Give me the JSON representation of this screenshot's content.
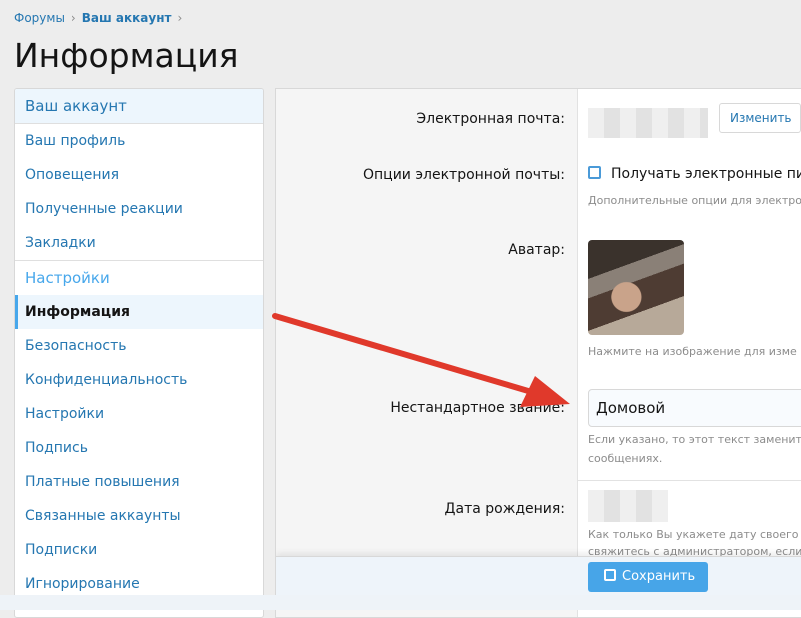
{
  "breadcrumb": [
    "Форумы",
    "Ваш аккаунт"
  ],
  "page_title": "Информация",
  "sidebar": {
    "header": "Ваш аккаунт",
    "account_items": [
      "Ваш профиль",
      "Оповещения",
      "Полученные реакции",
      "Закладки"
    ],
    "settings_header": "Настройки",
    "settings_items": [
      "Информация",
      "Безопасность",
      "Конфиденциальность",
      "Настройки",
      "Подпись",
      "Платные повышения",
      "Связанные аккаунты",
      "Подписки",
      "Игнорирование"
    ]
  },
  "form": {
    "email_label": "Электронная почта:",
    "change_button": "Изменить",
    "email_options_label": "Опции электронной почты:",
    "email_checkbox": "Получать электронные пи",
    "email_options_hint": "Дополнительные опции для электро",
    "avatar_label": "Аватар:",
    "avatar_hint": "Нажмите на изображение для изме",
    "title_label": "Нестандартное звание:",
    "title_value": "Домовой",
    "title_hint_1": "Если указано, то этот текст заменит",
    "title_hint_2": "сообщениях.",
    "dob_label": "Дата рождения:",
    "dob_hint_1": "Как только Вы укажете дату своего ,",
    "dob_hint_2": "свяжитесь с администратором, если",
    "save_button": "Сохранить"
  },
  "colors": {
    "accent": "#47a5e8",
    "link": "#2577b1",
    "arrow": "#e0392b"
  }
}
